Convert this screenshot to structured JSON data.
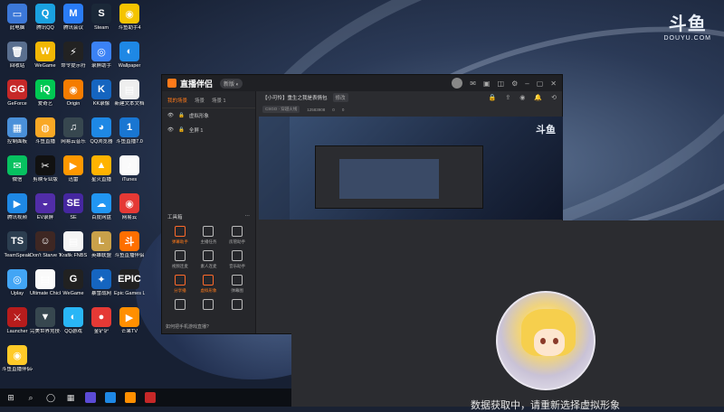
{
  "watermark": {
    "logo": "斗鱼",
    "sub": "DOUYU.COM"
  },
  "desktop_icons": [
    {
      "label": "此电脑",
      "color": "#3c78d8",
      "glyph": "▭"
    },
    {
      "label": "腾讯QQ",
      "color": "#1aa1e0",
      "glyph": "Q"
    },
    {
      "label": "腾讯会议",
      "color": "#2a7cf6",
      "glyph": "M"
    },
    {
      "label": "Steam",
      "color": "#1b2838",
      "glyph": "S"
    },
    {
      "label": "斗鱼助手4",
      "color": "#f5c400",
      "glyph": "◉"
    },
    {
      "label": "回收站",
      "color": "#5a6f8f",
      "glyph": "🗑"
    },
    {
      "label": "WeGame",
      "color": "#f2b705",
      "glyph": "W"
    },
    {
      "label": "命令提示符",
      "color": "#222",
      "glyph": "⚡"
    },
    {
      "label": "录屏助手",
      "color": "#3b82f6",
      "glyph": "◎"
    },
    {
      "label": "Wallpaper",
      "color": "#1e88e5",
      "glyph": "◐"
    },
    {
      "label": "GeForce",
      "color": "#c62828",
      "glyph": "GG"
    },
    {
      "label": "爱奇艺",
      "color": "#00c853",
      "glyph": "iQ"
    },
    {
      "label": "Origin",
      "color": "#f57c00",
      "glyph": "◉"
    },
    {
      "label": "KK录像",
      "color": "#1565c0",
      "glyph": "K"
    },
    {
      "label": "新建文本文档",
      "color": "#eeeeee",
      "glyph": "▤"
    },
    {
      "label": "控制面板",
      "color": "#4a90d9",
      "glyph": "▦"
    },
    {
      "label": "斗鱼直播",
      "color": "#f9a825",
      "glyph": "◍"
    },
    {
      "label": "网易云音乐",
      "color": "#37474f",
      "glyph": "♫"
    },
    {
      "label": "QQ浏览器",
      "color": "#1e88e5",
      "glyph": "◕"
    },
    {
      "label": "斗鱼直播7.0",
      "color": "#1976d2",
      "glyph": "1"
    },
    {
      "label": "微信",
      "color": "#07c160",
      "glyph": "✉"
    },
    {
      "label": "剪映专业版",
      "color": "#111",
      "glyph": "✂"
    },
    {
      "label": "迅雷",
      "color": "#ff9800",
      "glyph": "▶"
    },
    {
      "label": "星火直播",
      "color": "#ffb300",
      "glyph": "▲"
    },
    {
      "label": "iTunes",
      "color": "#fafafa",
      "glyph": "♪"
    },
    {
      "label": "腾讯视频",
      "color": "#1e88e5",
      "glyph": "▶"
    },
    {
      "label": "EV录屏",
      "color": "#512da8",
      "glyph": "◒"
    },
    {
      "label": "SE",
      "color": "#4527a0",
      "glyph": "SE"
    },
    {
      "label": "百度网盘",
      "color": "#2196f3",
      "glyph": "☁"
    },
    {
      "label": "网易云",
      "color": "#e53935",
      "glyph": "◉"
    },
    {
      "label": "TeamSpeak",
      "color": "#2c3e50",
      "glyph": "TS"
    },
    {
      "label": "Don't Starve Together",
      "color": "#3e2723",
      "glyph": "☺"
    },
    {
      "label": "Krafik FNBS",
      "color": "#f5f5f5",
      "glyph": "▤"
    },
    {
      "label": "英雄联盟",
      "color": "#c9a14a",
      "glyph": "L"
    },
    {
      "label": "斗鱼直播伴侣",
      "color": "#ff6f00",
      "glyph": "斗"
    },
    {
      "label": "Uplay",
      "color": "#42a5f5",
      "glyph": "◎"
    },
    {
      "label": "Ultimate Chicken",
      "color": "#fafafa",
      "glyph": "▤"
    },
    {
      "label": "WeGame",
      "color": "#212121",
      "glyph": "G"
    },
    {
      "label": "暴雪战网",
      "color": "#1565c0",
      "glyph": "✦"
    },
    {
      "label": "Epic Games Launcher",
      "color": "#212121",
      "glyph": "EPIC"
    },
    {
      "label": "Launcher",
      "color": "#b71c1c",
      "glyph": "⚔"
    },
    {
      "label": "完美世界竞技平台",
      "color": "#37474f",
      "glyph": "▼"
    },
    {
      "label": "QQ游戏",
      "color": "#29b6f6",
      "glyph": "◐"
    },
    {
      "label": "金铲铲",
      "color": "#e53935",
      "glyph": "●"
    },
    {
      "label": "芒果TV",
      "color": "#ff8f00",
      "glyph": "▶"
    },
    {
      "label": "斗鱼直播伴侣4",
      "color": "#ffca28",
      "glyph": "◉"
    }
  ],
  "window": {
    "brand": "直播伴侣",
    "version": "新版 ◐",
    "left_tabs": [
      "我的场景",
      "场景",
      "场景 1"
    ],
    "scenes": [
      "虚拟形象",
      "全屏 1"
    ],
    "tools_title": "工具箱",
    "tools": [
      {
        "label": "弹幕助手",
        "orange": true
      },
      {
        "label": "主播任务",
        "orange": false
      },
      {
        "label": "房管助手",
        "orange": false
      },
      {
        "label": "视频连麦",
        "orange": false
      },
      {
        "label": "素人连麦",
        "orange": false
      },
      {
        "label": "音乐助手",
        "orange": false
      },
      {
        "label": "分享播",
        "orange": true
      },
      {
        "label": "虚拟形象",
        "orange": true
      },
      {
        "label": "弹幕图",
        "orange": false
      },
      {
        "label": "",
        "orange": false
      },
      {
        "label": "",
        "orange": false
      },
      {
        "label": "",
        "orange": false
      }
    ],
    "hint": "如何把手机游戏直播?",
    "room_title": "【小可怜】重生之我是表情包",
    "room_tag": "修改",
    "sub_items": [
      "CSGO · 穿越火线",
      "12583908",
      "0",
      "0"
    ]
  },
  "overlay": {
    "message": "数据获取中，请重新选择虚拟形象"
  }
}
